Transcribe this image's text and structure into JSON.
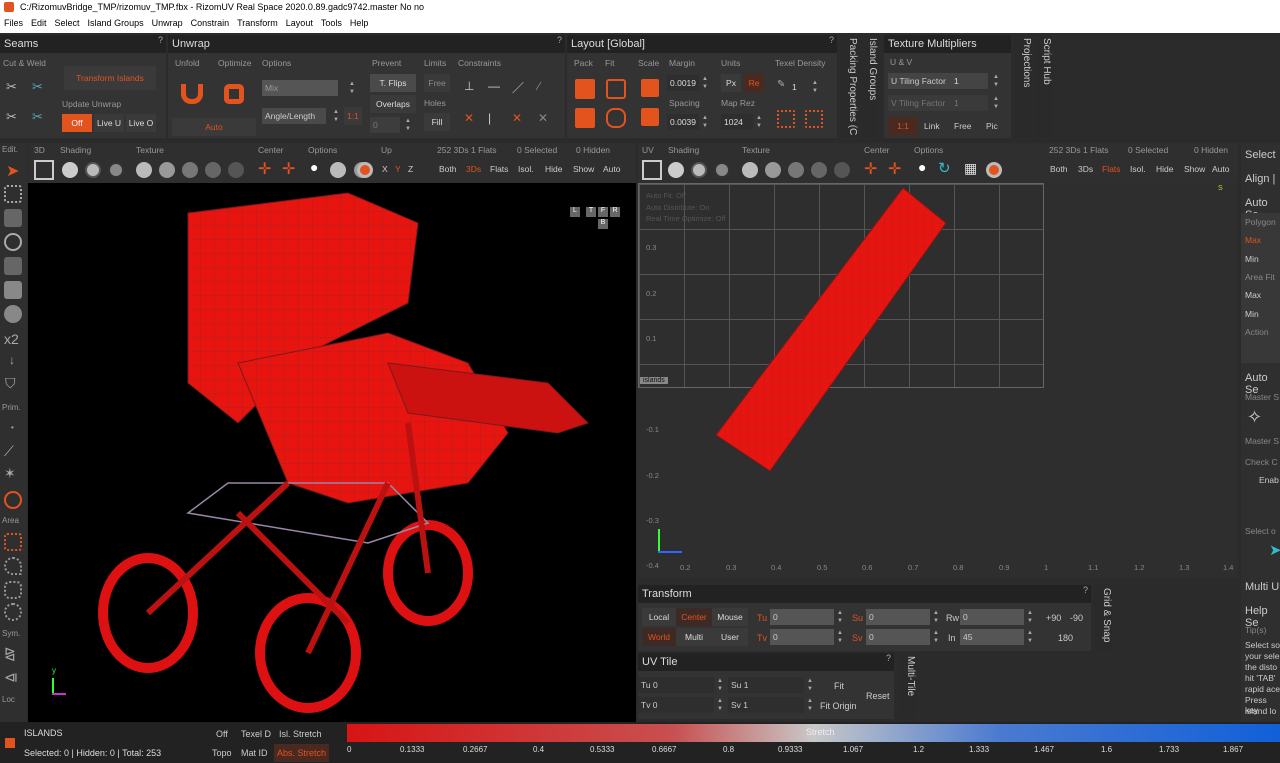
{
  "window": {
    "title": "C:/RizomuvBridge_TMP/rizomuv_TMP.fbx - RizomUV  Real Space 2020.0.89.gadc9742.master No no"
  },
  "menu": [
    "Files",
    "Edit",
    "Select",
    "Island Groups",
    "Unwrap",
    "Constrain",
    "Transform",
    "Layout",
    "Tools",
    "Help"
  ],
  "seams": {
    "title": "Seams",
    "cut_weld": "Cut & Weld",
    "transform_islands": "Transform Islands",
    "update_unwrap": "Update Unwrap",
    "off": "Off",
    "live_u": "Live U",
    "live_o": "Live O"
  },
  "unwrap": {
    "title": "Unwrap",
    "unfold": "Unfold",
    "optimize": "Optimize",
    "options": "Options",
    "mix": "Mix",
    "angle_length": "Angle/Length",
    "ratio": "1:1",
    "auto": "Auto",
    "prevent": "Prevent",
    "tflips": "T. Flips",
    "overlaps": "Overlaps",
    "zero": "0",
    "limits": "Limits",
    "free": "Free",
    "holes": "Holes",
    "fill": "Fill",
    "constraints": "Constraints"
  },
  "layout": {
    "title": "Layout [Global]",
    "pack": "Pack",
    "fit": "Fit",
    "scale": "Scale",
    "margin": "Margin",
    "margin_val": "0.0019",
    "spacing": "Spacing",
    "spacing_val": "0.0039",
    "units": "Units",
    "px": "Px",
    "re": "Re",
    "mapres": "Map Rez",
    "mapres_val": "1024",
    "texel": "Texel Density",
    "texel_val": "1"
  },
  "vtabs": {
    "packing": "Packing Properties (C",
    "island_groups": "Island Groups",
    "projections": "Projections",
    "script_hub": "Script Hub",
    "grid_snap": "Grid & Snap",
    "multi_tile": "Multi-Tile"
  },
  "texmult": {
    "title": "Texture Multipliers",
    "uv": "U & V",
    "u_label": "U Tiling Factor",
    "u_val": "1",
    "v_label": "V Tiling Factor",
    "v_val": "1",
    "ratio": "1:1",
    "link": "Link",
    "free": "Free",
    "pic": "Pic"
  },
  "sidebar": {
    "edit": "Edit.",
    "prim": "Prim.",
    "area": "Area",
    "sym": "Sym.",
    "loc": "Loc",
    "x2": "x2"
  },
  "view3d": {
    "label": "3D",
    "shading": "Shading",
    "texture": "Texture",
    "center": "Center",
    "options": "Options",
    "up": "Up",
    "x": "X",
    "y": "Y",
    "z": "Z",
    "stats": "252 3Ds 1 Flats",
    "selected": "0 Selected",
    "hidden": "0 Hidden",
    "both": "Both",
    "d3s": "3Ds",
    "flats": "Flats",
    "isol": "Isol.",
    "hide": "Hide",
    "show": "Show",
    "auto": "Auto",
    "cube": [
      "T",
      "L",
      "F",
      "R",
      "B",
      "B"
    ]
  },
  "viewuv": {
    "label": "UV",
    "shading": "Shading",
    "texture": "Texture",
    "center": "Center",
    "options": "Options",
    "stats": "252 3Ds 1 Flats",
    "selected": "0 Selected",
    "hidden": "0 Hidden",
    "both": "Both",
    "d3s": "3Ds",
    "flats": "Flats",
    "isol": "Isol.",
    "hide": "Hide",
    "show": "Show",
    "auto": "Auto",
    "info1": "Auto Fit: Off",
    "info2": "Auto Distribute: On",
    "info3": "Real Time Optimize: Off",
    "islands": "islands",
    "yticks": [
      "0.3",
      "0.2",
      "0.1",
      "-0.1",
      "-0.2",
      "-0.3",
      "-0.4"
    ],
    "xticks": [
      "0.2",
      "0.3",
      "0.4",
      "0.5",
      "0.6",
      "0.7",
      "0.8",
      "0.9",
      "1",
      "1.1",
      "1.2",
      "1.3",
      "1.4"
    ],
    "s": "S"
  },
  "transform": {
    "title": "Transform",
    "local": "Local",
    "center": "Center",
    "mouse": "Mouse",
    "world": "World",
    "multi": "Multi",
    "user": "User",
    "tu": "Tu",
    "tv": "Tv",
    "su": "Su",
    "sv": "Sv",
    "rw": "Rw",
    "in": "In",
    "tu_val": "0",
    "tv_val": "0",
    "su_val": "0",
    "sv_val": "0",
    "rw_val": "0",
    "in_val": "45",
    "p90": "+90",
    "m90": "-90",
    "r180": "180"
  },
  "uvtile": {
    "title": "UV Tile",
    "tu": "Tu 0",
    "tv": "Tv 0",
    "su": "Su 1",
    "sv": "Sv 1",
    "fit": "Fit",
    "fit_origin": "Fit Origin",
    "reset": "Reset"
  },
  "right": {
    "select": "Select",
    "align": "Align |",
    "auto_s": "Auto Se",
    "polygon": "Polygon",
    "max": "Max",
    "min": "Min",
    "area_fit": "Area Fit",
    "max2": "Max",
    "min2": "Min",
    "action": "Action",
    "auto_s2": "Auto Se",
    "master_s": "Master S",
    "master_s2": "Master S",
    "check_c": "Check C",
    "enab": "Enab",
    "select_o": "Select o",
    "multi_u": "Multi U",
    "help_s": "Help Se",
    "tips": "Tip(s)",
    "help_lines": [
      "Select so",
      "your sele",
      "the disto",
      "hit 'TAB'",
      "rapid ace",
      "Press key",
      "island lo"
    ]
  },
  "status": {
    "islands": "ISLANDS",
    "counts": "Selected: 0 | Hidden: 0 | Total: 253",
    "off": "Off",
    "texel_d": "Texel D",
    "isl_stretch": "Isl. Stretch",
    "topo": "Topo",
    "mat_id": "Mat ID",
    "abs_stretch": "Abs. Stretch",
    "stretch": "Stretch",
    "ticks": [
      "0",
      "0.1333",
      "0.2667",
      "0.4",
      "0.5333",
      "0.6667",
      "0.8",
      "0.9333",
      "1.067",
      "1.2",
      "1.333",
      "1.467",
      "1.6",
      "1.733",
      "1.867"
    ]
  },
  "colors": {
    "accent": "#e2531e",
    "mesh": "#e8140f"
  }
}
